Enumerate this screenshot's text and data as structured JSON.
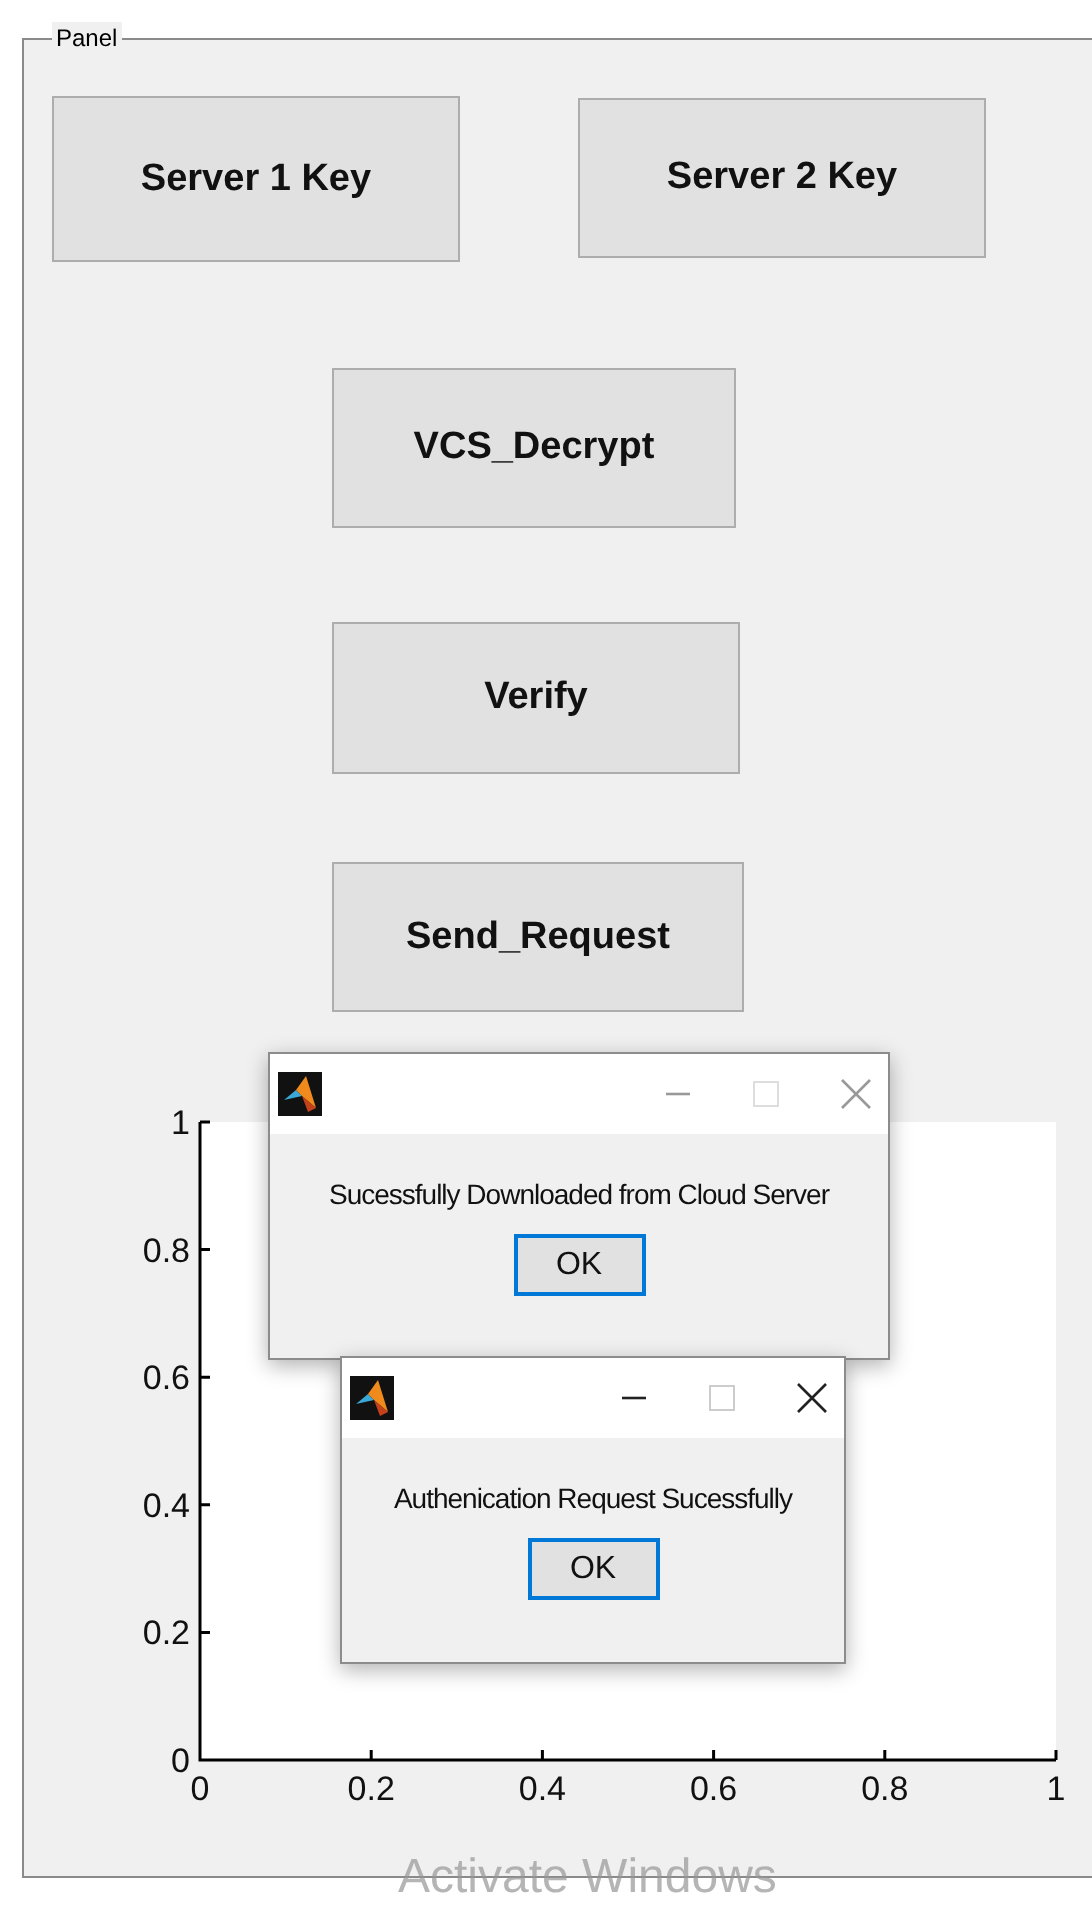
{
  "panel": {
    "title": "Panel",
    "button_rows": [
      {
        "buttons": [
          {
            "label": "Server 1 Key"
          },
          {
            "label": "Server 2 Key"
          }
        ]
      },
      {
        "buttons": [
          {
            "label": "VCS_Decrypt"
          }
        ]
      },
      {
        "buttons": [
          {
            "label": "Verify"
          }
        ]
      },
      {
        "buttons": [
          {
            "label": "Send_Request"
          }
        ]
      }
    ],
    "axes": {
      "chart_data": {
        "type": "line",
        "xlim": [
          0,
          1
        ],
        "ylim": [
          0,
          1
        ],
        "xticks": [
          {
            "value": 0,
            "label": "0"
          },
          {
            "value": 0.2,
            "label": "0.2"
          },
          {
            "value": 0.4,
            "label": "0.4"
          },
          {
            "value": 0.6,
            "label": "0.6"
          },
          {
            "value": 0.8,
            "label": "0.8"
          },
          {
            "value": 1,
            "label": "1"
          }
        ],
        "yticks": [
          {
            "value": 0,
            "label": "0"
          },
          {
            "value": 0.2,
            "label": "0.2"
          },
          {
            "value": 0.4,
            "label": "0.4"
          },
          {
            "value": 0.6,
            "label": "0.6"
          },
          {
            "value": 0.8,
            "label": "0.8"
          },
          {
            "value": 1,
            "label": "1"
          }
        ]
      }
    }
  },
  "dialogs": [
    {
      "message": "Sucessfully Downloaded from Cloud Server",
      "button": "OK",
      "active": false
    },
    {
      "message": "Authenication Request Sucessfully",
      "button": "OK",
      "active": true
    }
  ],
  "os_notice": "Activate Windows"
}
